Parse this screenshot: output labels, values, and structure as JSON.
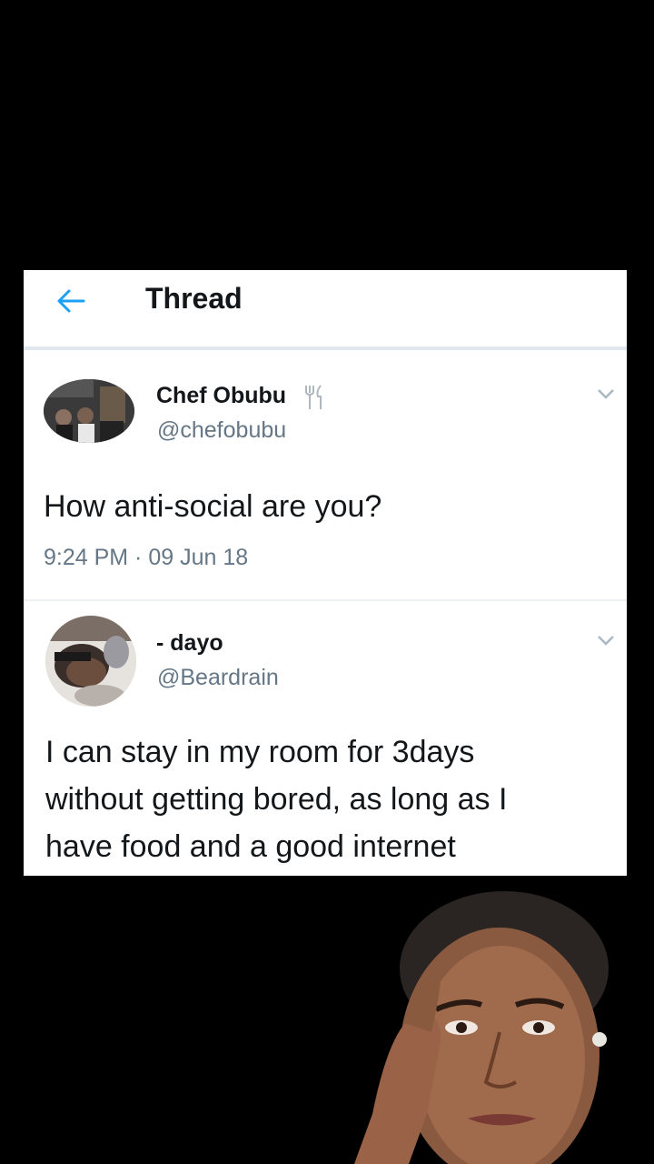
{
  "header": {
    "title": "Thread"
  },
  "tweets": [
    {
      "name": "Chef Obubu",
      "handle": "@chefobubu",
      "badge_icon": "fork-knife-icon",
      "text": "How anti-social are you?",
      "timestamp": "9:24 PM · 09 Jun 18"
    },
    {
      "name": "- dayo",
      "handle": "@Beardrain",
      "text_lines": [
        "I can stay in my room for 3days",
        "without getting bored, as long as I",
        "have food and a good internet"
      ]
    }
  ],
  "colors": {
    "accent": "#1da1f2",
    "text": "#14171a",
    "secondary": "#657786",
    "background": "#000000"
  }
}
